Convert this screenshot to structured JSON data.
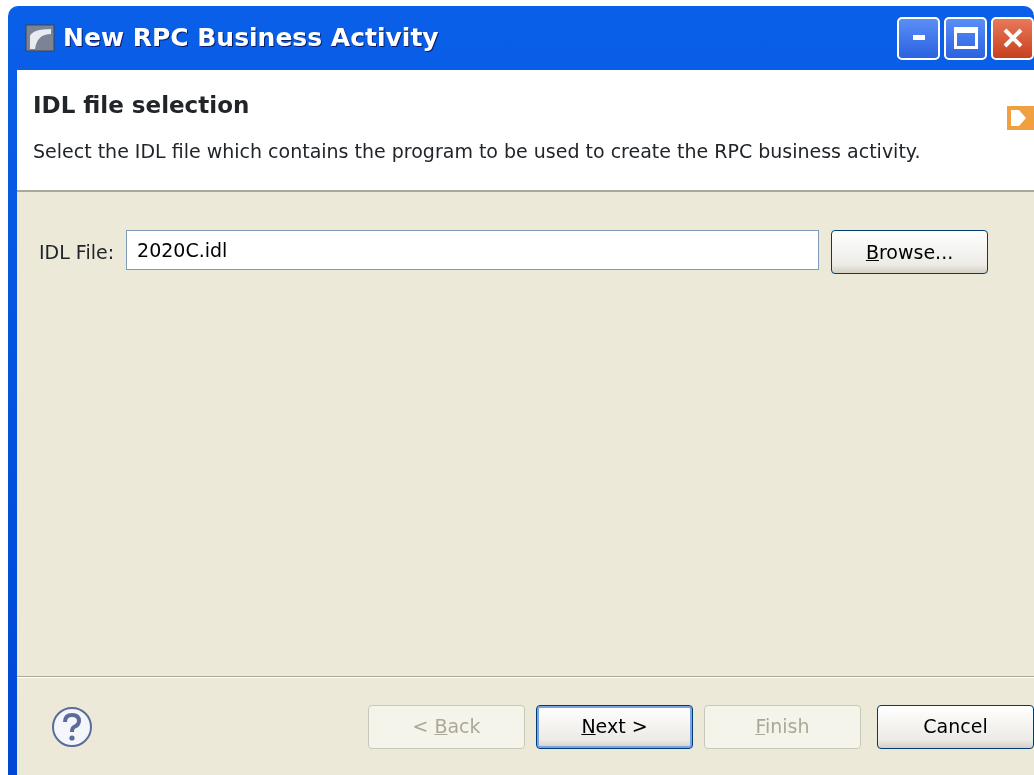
{
  "window": {
    "title": "New RPC Business Activity"
  },
  "header": {
    "title": "IDL file selection",
    "description": "Select the IDL file which contains the program to be used to create the RPC business activity."
  },
  "idl_file": {
    "label": "IDL File:",
    "value": "2020C.idl",
    "browse": {
      "key": "B",
      "after": "rowse..."
    }
  },
  "buttons": [
    {
      "before": "< ",
      "key": "B",
      "after": "ack",
      "disabled": true,
      "default": false
    },
    {
      "key": "N",
      "after": "ext >",
      "disabled": false,
      "default": true
    },
    {
      "key": "F",
      "after": "inish",
      "disabled": true,
      "default": false
    },
    {
      "label": "Cancel",
      "disabled": false,
      "default": false
    }
  ]
}
